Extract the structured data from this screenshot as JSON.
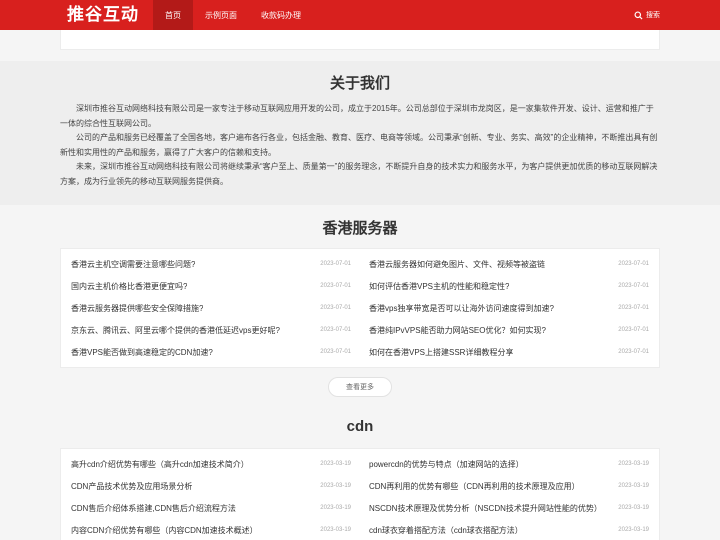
{
  "header": {
    "logo": "推谷互动",
    "nav": [
      "首页",
      "示例页面",
      "收款码办理"
    ],
    "search_label": "搜索"
  },
  "colors": {
    "brand": "#d8201e",
    "nav_active": "#b31a18"
  },
  "about": {
    "title": "关于我们",
    "paragraphs": [
      "深圳市推谷互动网络科技有限公司是一家专注于移动互联网应用开发的公司，成立于2015年。公司总部位于深圳市龙岗区，是一家集软件开发、设计、运营和推广于一体的综合性互联网公司。",
      "公司的产品和服务已经覆盖了全国各地，客户遍布各行各业，包括金融、教育、医疗、电商等领域。公司秉承“创新、专业、务实、高效”的企业精神，不断推出具有创新性和实用性的产品和服务，赢得了广大客户的信赖和支持。",
      "未来，深圳市推谷互动网络科技有限公司将继续秉承“客户至上、质量第一”的服务理念，不断提升自身的技术实力和服务水平，为客户提供更加优质的移动互联网解决方案，成为行业领先的移动互联网服务提供商。"
    ]
  },
  "hk": {
    "title": "香港服务器",
    "left": [
      {
        "title": "香港云主机空调需要注意哪些问题?",
        "date": "2023-07-01"
      },
      {
        "title": "国内云主机价格比香港更便宜吗?",
        "date": "2023-07-01"
      },
      {
        "title": "香港云服务器提供哪些安全保障措施?",
        "date": "2023-07-01"
      },
      {
        "title": "京东云、腾讯云、阿里云哪个提供的香港低延迟vps更好呢?",
        "date": "2023-07-01"
      },
      {
        "title": "香港VPS能否做到高速稳定的CDN加速?",
        "date": "2023-07-01"
      }
    ],
    "right": [
      {
        "title": "香港云服务器如何避免图片、文件、视频等被盗链",
        "date": "2023-07-01"
      },
      {
        "title": "如何评估香港VPS主机的性能和稳定性?",
        "date": "2023-07-01"
      },
      {
        "title": "香港vps独享带宽是否可以让海外访问速度得到加速?",
        "date": "2023-07-01"
      },
      {
        "title": "香港纯IPvVPS能否助力网站SEO优化？如何实现?",
        "date": "2023-07-01"
      },
      {
        "title": "如何在香港VPS上搭建SSR详细教程分享",
        "date": "2023-07-01"
      }
    ],
    "more_label": "查看更多"
  },
  "cdn": {
    "title": "cdn",
    "left": [
      {
        "title": "高升cdn介绍优势有哪些（高升cdn加速技术简介）",
        "date": "2023-03-19"
      },
      {
        "title": "CDN产品技术优势及应用场景分析",
        "date": "2023-03-19"
      },
      {
        "title": "CDN售后介绍体系搭建,CDN售后介绍流程方法",
        "date": "2023-03-19"
      },
      {
        "title": "内容CDN介绍优势有哪些（内容CDN加速技术概述）",
        "date": "2023-03-19"
      }
    ],
    "right": [
      {
        "title": "powercdn的优势与特点（加速网站的选择）",
        "date": "2023-03-19"
      },
      {
        "title": "CDN再利用的优势有哪些（CDN再利用的技术原理及应用）",
        "date": "2023-03-19"
      },
      {
        "title": "NSCDN技术原理及优势分析（NSCDN技术提升网站性能的优势）",
        "date": "2023-03-19"
      },
      {
        "title": "cdn球衣穿着搭配方法（cdn球衣搭配方法）",
        "date": "2023-03-19"
      }
    ]
  }
}
